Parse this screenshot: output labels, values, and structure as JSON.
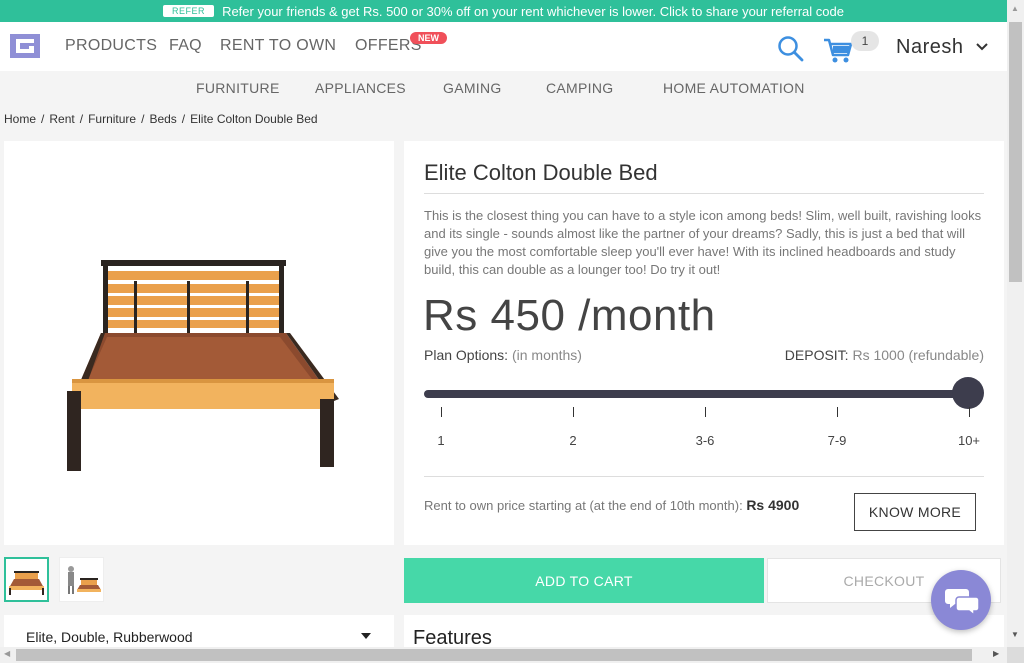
{
  "banner": {
    "tag": "REFER",
    "text": "Refer your friends & get Rs. 500 or 30% off on your rent whichever is lower. Click to share your referral code"
  },
  "header": {
    "nav": [
      "PRODUCTS",
      "FAQ",
      "RENT TO OWN",
      "OFFERS"
    ],
    "offers_badge": "NEW",
    "cart_count": "1",
    "user_name": "Naresh"
  },
  "categories": [
    "FURNITURE",
    "APPLIANCES",
    "GAMING",
    "CAMPING",
    "HOME AUTOMATION"
  ],
  "breadcrumb": [
    "Home",
    "Rent",
    "Furniture",
    "Beds",
    "Elite Colton Double Bed"
  ],
  "product": {
    "title": "Elite Colton Double Bed",
    "description": "This is the closest thing you can have to a style icon among beds! Slim, well built, ravishing looks and its single - sounds almost like the partner of your dreams? Sadly, this is just a bed that will give you the most comfortable sleep you'll ever have! With its inclined headboards and study build, this can double as a lounger too! Do try it out!",
    "price": "Rs 450 /month",
    "plan_label": "Plan Options:",
    "plan_unit": "(in months)",
    "deposit_label": "DEPOSIT:",
    "deposit_value": "Rs 1000 (refundable)",
    "plan_options": [
      "1",
      "2",
      "3-6",
      "7-9",
      "10+"
    ],
    "selected_plan": "10+",
    "rto_text": "Rent to own price starting at (at the end of 10th month):",
    "rto_price": "Rs 4900",
    "know_more": "KNOW MORE",
    "variant": "Elite, Double, Rubberwood"
  },
  "actions": {
    "add_to_cart": "ADD TO CART",
    "checkout": "CHECKOUT"
  },
  "features_heading": "Features",
  "colors": {
    "brand": "#2fc09a",
    "add_to_cart": "#46d8a8",
    "slider": "#3d3d4d",
    "badge": "#f0505a",
    "logo": "#8f8fd6"
  }
}
